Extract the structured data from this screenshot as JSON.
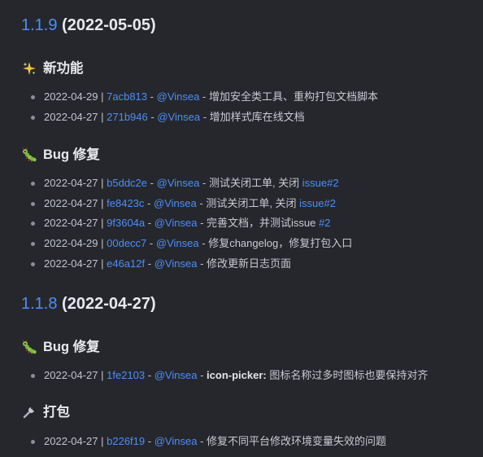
{
  "releases": [
    {
      "version": "1.1.9",
      "date": "(2022-05-05)",
      "sections": [
        {
          "icon": "sparkles-icon",
          "title": "新功能",
          "entries": [
            {
              "date": "2022-04-29",
              "hash": "7acb813",
              "author": "@Vinsea",
              "message": "增加安全类工具、重构打包文档脚本"
            },
            {
              "date": "2022-04-27",
              "hash": "271b946",
              "author": "@Vinsea",
              "message": "增加样式库在线文档"
            }
          ]
        },
        {
          "icon": "bug-icon",
          "title": "Bug 修复",
          "entries": [
            {
              "date": "2022-04-27",
              "hash": "b5ddc2e",
              "author": "@Vinsea",
              "message": "测试关闭工单, 关闭 ",
              "link": "issue#2"
            },
            {
              "date": "2022-04-27",
              "hash": "fe8423c",
              "author": "@Vinsea",
              "message": "测试关闭工单, 关闭 ",
              "link": "issue#2"
            },
            {
              "date": "2022-04-27",
              "hash": "9f3604a",
              "author": "@Vinsea",
              "message": "完善文档，并测试issue ",
              "link": "#2"
            },
            {
              "date": "2022-04-29",
              "hash": "00decc7",
              "author": "@Vinsea",
              "message": "修复changelog，修复打包入口"
            },
            {
              "date": "2022-04-27",
              "hash": "e46a12f",
              "author": "@Vinsea",
              "message": "修改更新日志页面"
            }
          ]
        }
      ]
    },
    {
      "version": "1.1.8",
      "date": "(2022-04-27)",
      "sections": [
        {
          "icon": "bug-icon",
          "title": "Bug 修复",
          "entries": [
            {
              "date": "2022-04-27",
              "hash": "1fe2103",
              "author": "@Vinsea",
              "scope": "icon-picker:",
              "message": " 图标名称过多时图标也要保持对齐"
            }
          ]
        },
        {
          "icon": "wrench-icon",
          "title": "打包",
          "entries": [
            {
              "date": "2022-04-27",
              "hash": "b226f19",
              "author": "@Vinsea",
              "message": "修复不同平台修改环境变量失效的问题"
            }
          ]
        }
      ]
    }
  ],
  "separator": "|",
  "dash": "-",
  "colors": {
    "background": "#25272d",
    "link": "#4f8ef5",
    "text": "#d4d6db"
  }
}
